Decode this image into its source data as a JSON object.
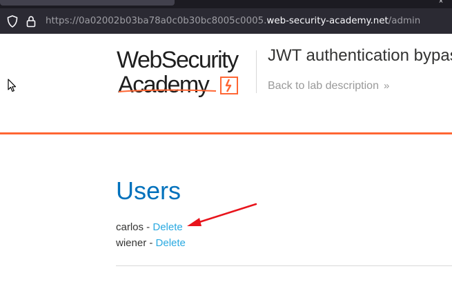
{
  "browser": {
    "url_prefix": "https://0a02002b03ba78a0c0b30bc8005c0005.",
    "url_host": "web-security-academy.net",
    "url_path": "/admin",
    "close_glyph": "×"
  },
  "header": {
    "logo_line1": "WebSecurity",
    "logo_line2": "Academy",
    "lab_title": "JWT authentication bypass",
    "back_link": "Back to lab description",
    "back_chevron": "»"
  },
  "content": {
    "heading": "Users",
    "users": [
      {
        "name": "carlos",
        "separator": " - ",
        "action": "Delete"
      },
      {
        "name": "wiener",
        "separator": " - ",
        "action": "Delete"
      }
    ]
  },
  "colors": {
    "accent_orange": "#ff6633",
    "heading_blue": "#0071bc",
    "link_blue": "#29a9e1",
    "annotation_red": "#e8141c"
  },
  "icons": [
    "shield-icon",
    "lock-icon",
    "mouse-cursor-icon",
    "academy-logo-mark-icon"
  ]
}
